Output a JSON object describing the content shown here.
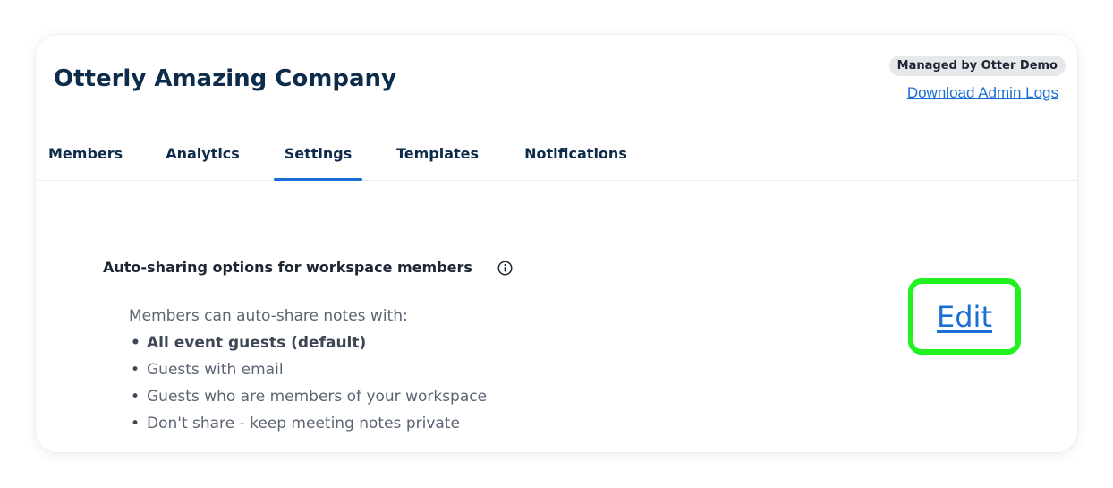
{
  "workspace": {
    "name": "Otterly Amazing Company",
    "managed_badge": "Managed by Otter Demo",
    "download_logs_label": "Download Admin Logs"
  },
  "tabs": [
    {
      "label": "Members",
      "active": false
    },
    {
      "label": "Analytics",
      "active": false
    },
    {
      "label": "Settings",
      "active": true
    },
    {
      "label": "Templates",
      "active": false
    },
    {
      "label": "Notifications",
      "active": false
    }
  ],
  "auto_sharing": {
    "title": "Auto-sharing options for workspace members",
    "info_icon": "info-icon",
    "intro": "Members can auto-share notes with:",
    "options": [
      {
        "label": "All event guests (default)",
        "default": true
      },
      {
        "label": "Guests with email",
        "default": false
      },
      {
        "label": "Guests who are members of your workspace",
        "default": false
      },
      {
        "label": "Don't share - keep meeting notes private",
        "default": false
      }
    ],
    "edit_label": "Edit"
  },
  "colors": {
    "accent": "#1a6fd4",
    "heading": "#0d2b4a",
    "highlight": "#1ff21f",
    "badge_bg": "#e7e8ec"
  }
}
